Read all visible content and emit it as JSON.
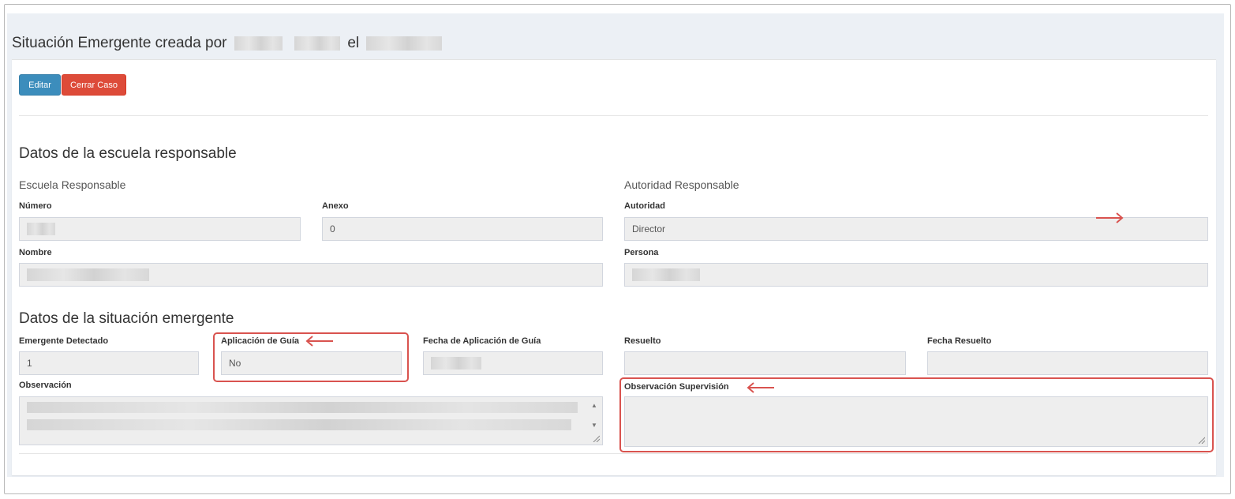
{
  "header": {
    "title_prefix": "Situación Emergente creada por",
    "title_mid": "el"
  },
  "toolbar": {
    "edit_label": "Editar",
    "close_case_label": "Cerrar Caso"
  },
  "school_section": {
    "title": "Datos de la escuela responsable",
    "school_subtitle": "Escuela Responsable",
    "authority_subtitle": "Autoridad Responsable",
    "numero_label": "Número",
    "anexo_label": "Anexo",
    "anexo_value": "0",
    "autoridad_label": "Autoridad",
    "autoridad_value": "Director",
    "nombre_label": "Nombre",
    "persona_label": "Persona"
  },
  "emergency_section": {
    "title": "Datos de la situación emergente",
    "detectado_label": "Emergente Detectado",
    "detectado_value": "1",
    "aplicacion_label": "Aplicación de Guía",
    "aplicacion_value": "No",
    "fecha_aplicacion_label": "Fecha de Aplicación de Guía",
    "resuelto_label": "Resuelto",
    "resuelto_value": "",
    "fecha_resuelto_label": "Fecha Resuelto",
    "fecha_resuelto_value": "",
    "observacion_label": "Observación",
    "observacion_supervision_label": "Observación Supervisión",
    "observacion_supervision_value": ""
  },
  "annotation_color": "#d9534f",
  "icons": [
    "arrow-left-icon",
    "arrow-right-icon",
    "resize-grip-icon",
    "scroll-arrow-icon"
  ]
}
